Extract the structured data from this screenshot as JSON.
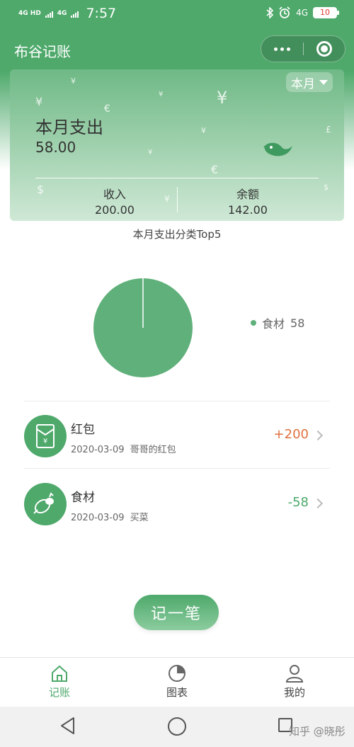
{
  "status_bar": {
    "network_1": "4G HD",
    "network_2": "4G",
    "time": "7:57",
    "right_network": "4G",
    "battery": "10"
  },
  "header": {
    "title": "布谷记账",
    "more_icon": "more-dots-icon",
    "close_icon": "target-icon"
  },
  "summary": {
    "period": "本月",
    "expense_label": "本月支出",
    "expense_value": "58.00",
    "income_label": "收入",
    "income_value": "200.00",
    "balance_label": "余额",
    "balance_value": "142.00",
    "decor_icon": "bird-icon",
    "colors": {
      "card_top": "#6fb986",
      "card_bottom": "#cfe8d6"
    }
  },
  "chart_title": "本月支出分类Top5",
  "chart_data": {
    "type": "pie",
    "title": "本月支出分类Top5",
    "categories": [
      "食材"
    ],
    "values": [
      58
    ],
    "legend_position": "right",
    "colors": [
      "#5fb07a"
    ]
  },
  "legend": [
    {
      "label": "食材",
      "value": "58"
    }
  ],
  "records": [
    {
      "category": "红包",
      "date": "2020-03-09",
      "note": "哥哥的红包",
      "amount": "+200",
      "type": "income",
      "icon": "red-envelope-icon"
    },
    {
      "category": "食材",
      "date": "2020-03-09",
      "note": "买菜",
      "amount": "-58",
      "type": "expense",
      "icon": "vegetables-icon"
    }
  ],
  "add_button": "记一笔",
  "tabs": [
    {
      "label": "记账",
      "icon": "home-icon",
      "active": true
    },
    {
      "label": "图表",
      "icon": "pie-chart-icon",
      "active": false
    },
    {
      "label": "我的",
      "icon": "user-icon",
      "active": false
    }
  ],
  "watermark": "知乎 @晓彤",
  "colors": {
    "primary": "#4ea96b",
    "income": "#e0703e",
    "expense": "#4ea96b"
  }
}
